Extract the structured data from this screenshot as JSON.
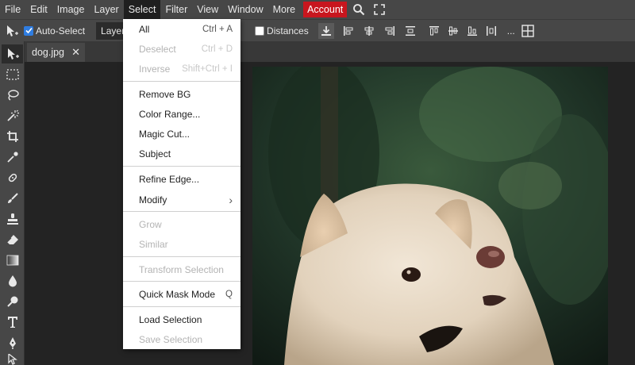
{
  "menubar": {
    "items": [
      "File",
      "Edit",
      "Image",
      "Layer",
      "Select",
      "Filter",
      "View",
      "Window",
      "More"
    ],
    "account": "Account",
    "icons": [
      "search-icon",
      "fullscreen-icon"
    ]
  },
  "options": {
    "auto_select_label": "Auto-Select",
    "auto_select_checked": true,
    "layer_select": "Layer",
    "distances_label": "Distances",
    "distances_checked": false,
    "more": "..."
  },
  "tab": {
    "filename": "dog.jpg",
    "close": "✕"
  },
  "select_menu": {
    "items": [
      {
        "label": "All",
        "shortcut": "Ctrl + A",
        "enabled": true
      },
      {
        "label": "Deselect",
        "shortcut": "Ctrl + D",
        "enabled": false
      },
      {
        "label": "Inverse",
        "shortcut": "Shift+Ctrl + I",
        "enabled": false
      },
      {
        "label": "Remove BG",
        "shortcut": "",
        "enabled": true
      },
      {
        "label": "Color Range...",
        "shortcut": "",
        "enabled": true
      },
      {
        "label": "Magic Cut...",
        "shortcut": "",
        "enabled": true
      },
      {
        "label": "Subject",
        "shortcut": "",
        "enabled": true
      },
      {
        "label": "Refine Edge...",
        "shortcut": "",
        "enabled": true
      },
      {
        "label": "Modify",
        "shortcut": "›",
        "enabled": true
      },
      {
        "label": "Grow",
        "shortcut": "",
        "enabled": false
      },
      {
        "label": "Similar",
        "shortcut": "",
        "enabled": false
      },
      {
        "label": "Transform Selection",
        "shortcut": "",
        "enabled": false
      },
      {
        "label": "Quick Mask Mode",
        "shortcut": "Q",
        "enabled": true
      },
      {
        "label": "Load Selection",
        "shortcut": "",
        "enabled": true
      },
      {
        "label": "Save Selection",
        "shortcut": "",
        "enabled": false
      }
    ]
  },
  "colors": {
    "menubar_bg": "#474747",
    "workspace_bg": "#232323",
    "account_bg": "#c8161e",
    "checkbox_on": "#2f7de1"
  }
}
